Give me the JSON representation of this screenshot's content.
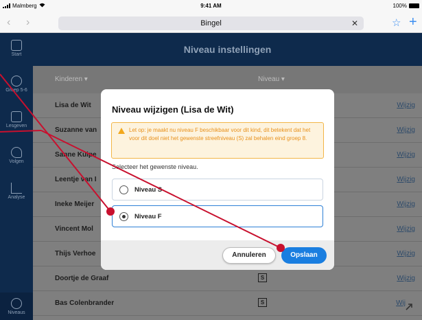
{
  "status_bar": {
    "carrier": "Malmberg",
    "time": "9:41 AM",
    "battery": "100%"
  },
  "browser": {
    "back_glyph": "‹",
    "forward_glyph": "›",
    "address": "Bingel",
    "clear_glyph": "✕",
    "bookmark_glyph": "☆",
    "new_tab_glyph": "+"
  },
  "sidebar": {
    "items": [
      {
        "label": "Start",
        "icon": "home-icon"
      },
      {
        "label": "Groep 5-6",
        "icon": "group-icon"
      },
      {
        "label": "Lesgeven",
        "icon": "teach-icon"
      },
      {
        "label": "Volgen",
        "icon": "follow-icon"
      },
      {
        "label": "Analyse",
        "icon": "chart-icon"
      },
      {
        "label": "Niveaus",
        "icon": "gear-icon"
      }
    ]
  },
  "page": {
    "title": "Niveau instellingen",
    "columns": {
      "children": "Kinderen ▾",
      "level": "Niveau ▾"
    },
    "rows": [
      {
        "name": "Lisa de Wit",
        "badge": "",
        "action": "Wijzig"
      },
      {
        "name": "Suzanne van",
        "badge": "",
        "action": "Wijzig"
      },
      {
        "name": "Sanne Kuipe",
        "badge": "",
        "action": "Wijzig"
      },
      {
        "name": "Leentje van I",
        "badge": "",
        "action": "Wijzig"
      },
      {
        "name": "Ineke Meijer",
        "badge": "",
        "action": "Wijzig"
      },
      {
        "name": "Vincent Mol",
        "badge": "",
        "action": "Wijzig"
      },
      {
        "name": "Thijs Verhoe",
        "badge": "",
        "action": "Wijzig"
      },
      {
        "name": "Doortje de Graaf",
        "badge": "S",
        "action": "Wijzig"
      },
      {
        "name": "Bas Colenbrander",
        "badge": "S",
        "action": "Wij"
      }
    ]
  },
  "modal": {
    "title": "Niveau wijzigen (Lisa de Wit)",
    "warning": "Let op: je maakt nu niveau F beschikbaar voor dit kind, dit betekent dat het voor dit doel niet het gewenste streefniveau (S) zal behalen eind groep 8.",
    "prompt": "Selecteer het gewenste niveau.",
    "options": [
      {
        "label": "Niveau S",
        "selected": false
      },
      {
        "label": "Niveau F",
        "selected": true
      }
    ],
    "cancel_label": "Annuleren",
    "save_label": "Opslaan"
  },
  "colors": {
    "accent": "#1a7ee0",
    "navy": "#0e2a4c",
    "warning": "#f2a81d",
    "annotation": "#c8102e"
  }
}
